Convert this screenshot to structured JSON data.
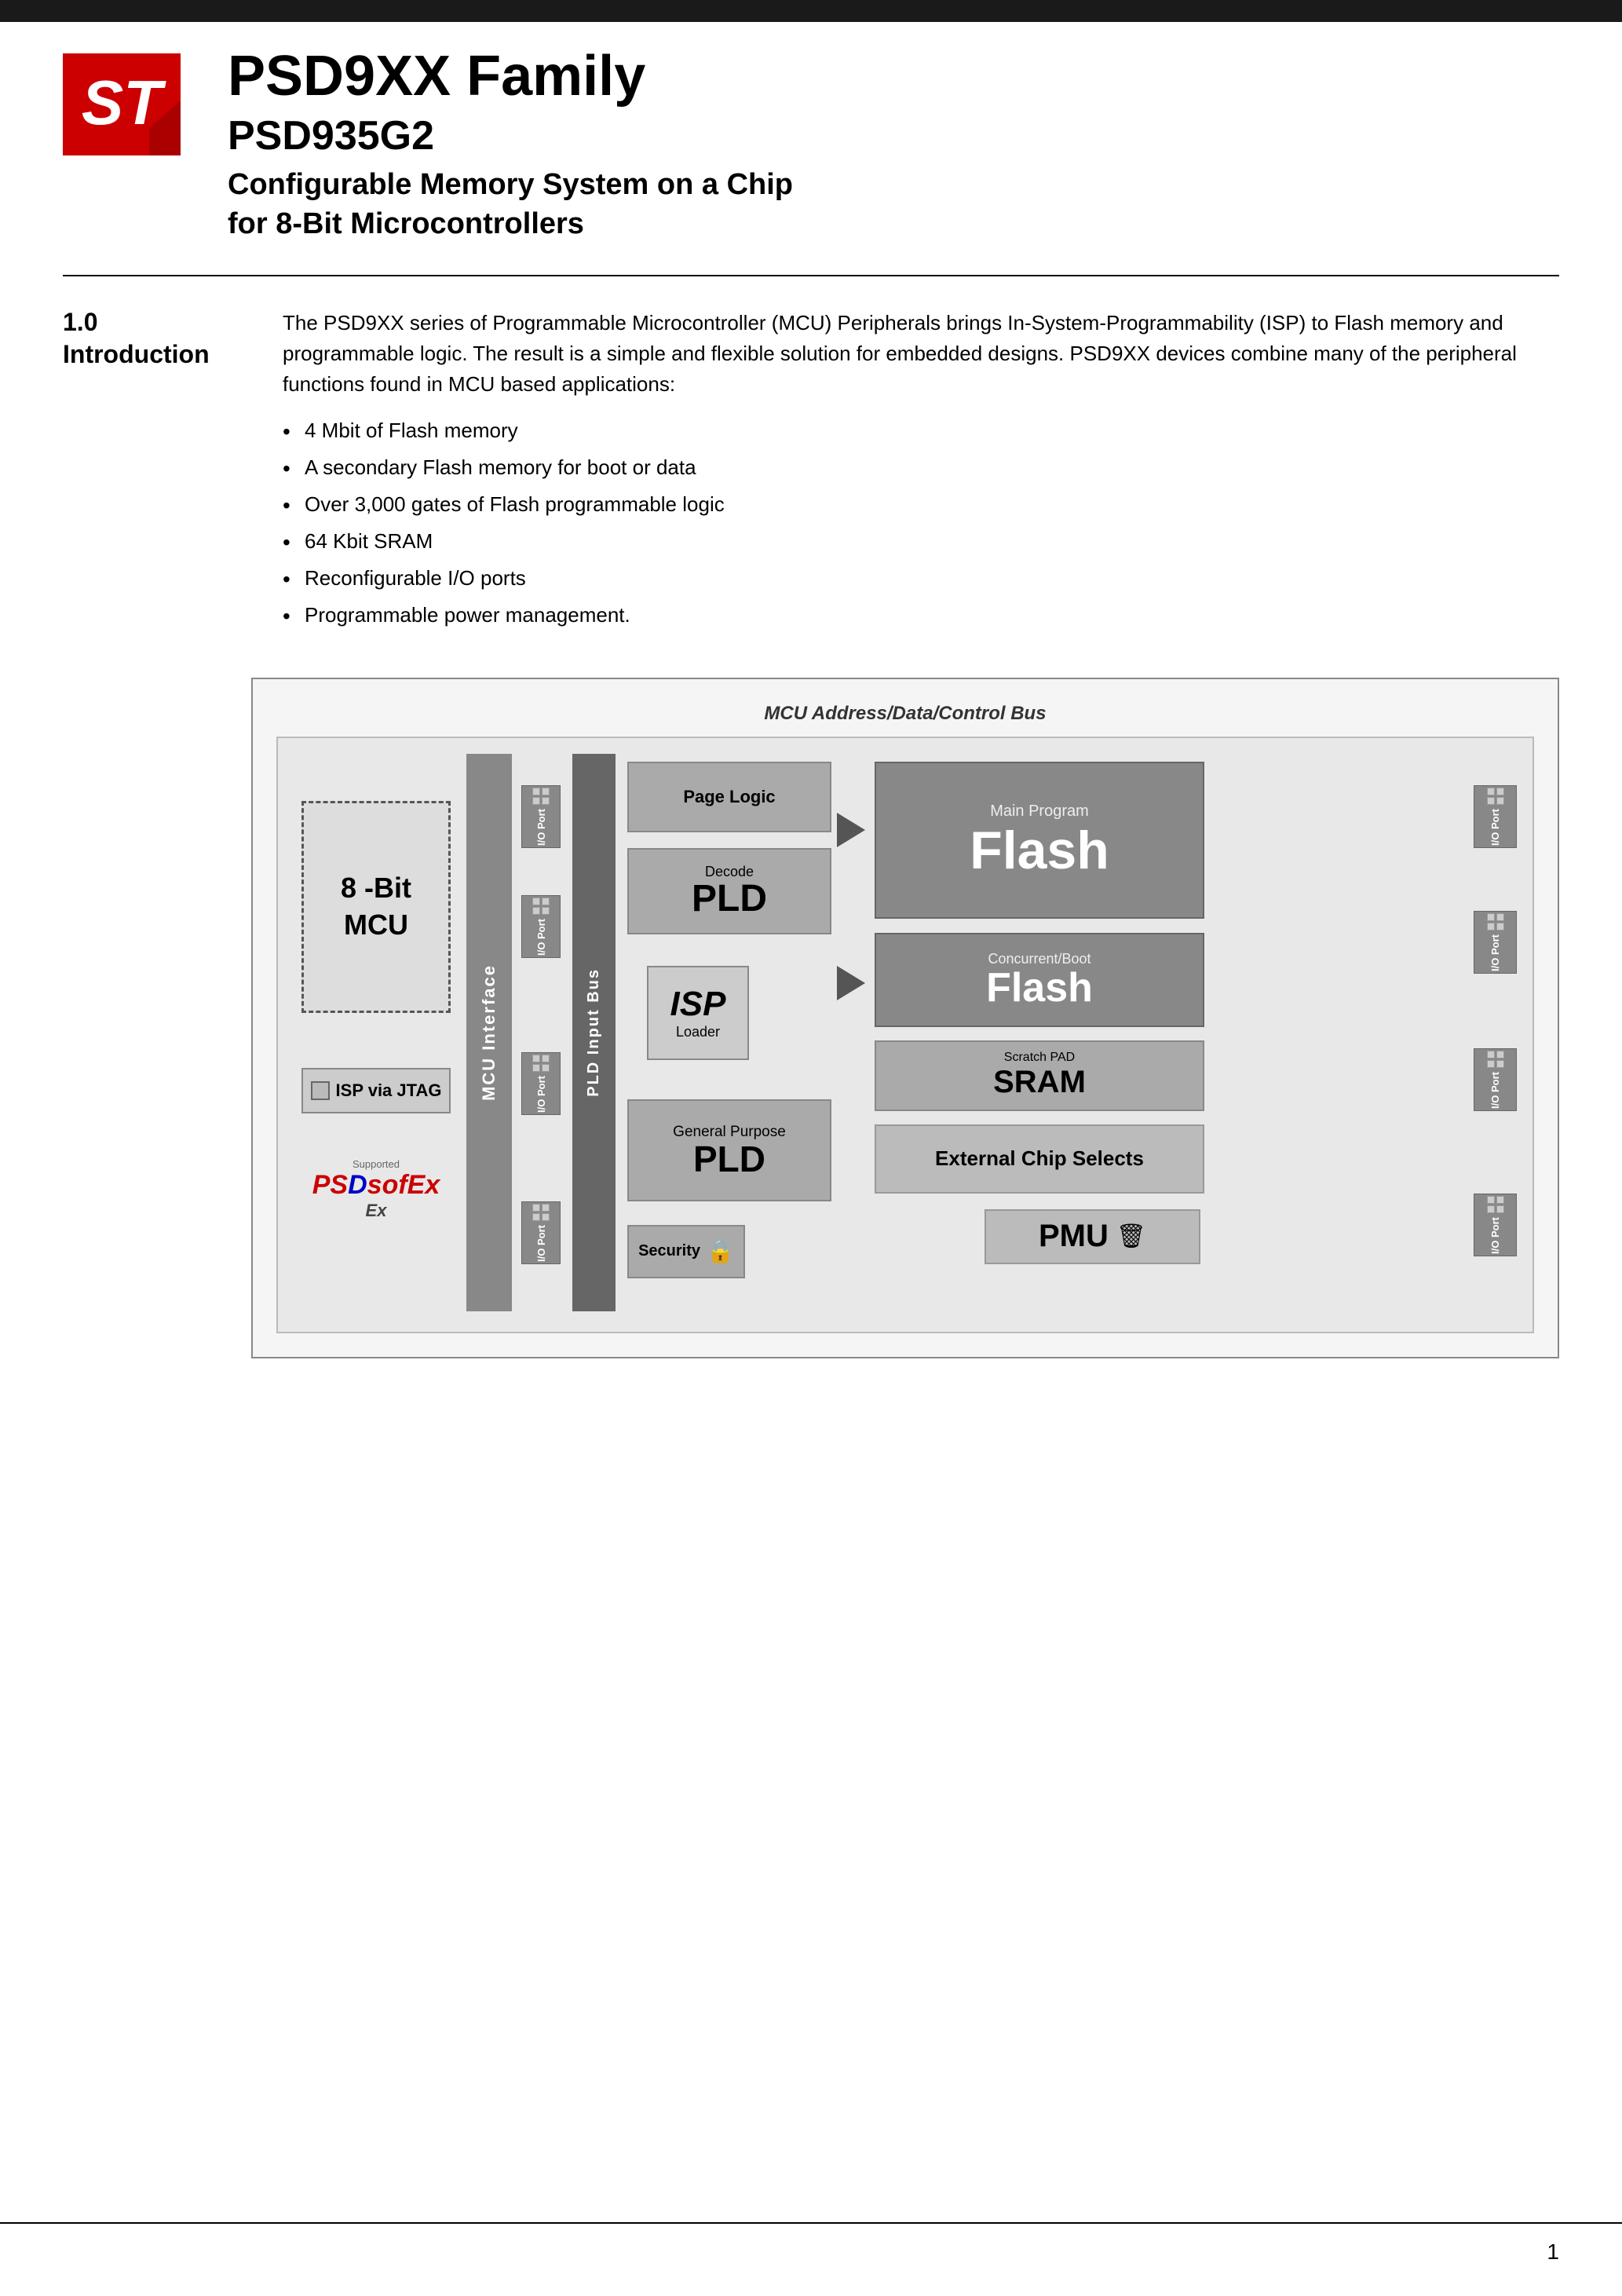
{
  "header": {
    "bar_color": "#1a1a1a",
    "product_family": "PSD9XX Family",
    "product_number": "PSD935G2",
    "product_description_line1": "Configurable Memory System on a Chip",
    "product_description_line2": "for 8-Bit Microcontrollers"
  },
  "section": {
    "number": "1.0",
    "title": "Introduction",
    "body_paragraph": "The PSD9XX series of Programmable Microcontroller (MCU) Peripherals brings In-System-Programmability (ISP) to Flash memory and programmable logic. The result is a simple and flexible solution for embedded designs. PSD9XX devices combine many of the peripheral functions found in MCU based applications:",
    "bullet_items": [
      "4 Mbit of Flash memory",
      "A secondary Flash memory for boot or data",
      "Over 3,000 gates of Flash programmable logic",
      "64 Kbit SRAM",
      "Reconfigurable I/O ports",
      "Programmable power management."
    ]
  },
  "diagram": {
    "bus_label": "MCU Address/Data/Control Bus",
    "mcu_label_line1": "8 -Bit",
    "mcu_label_line2": "MCU",
    "mcu_interface_label": "MCU Interface",
    "isp_jtag_label": "ISP via JTAG",
    "pld_input_bus_label": "PLD Input Bus",
    "page_logic_label": "Page Logic",
    "decode_label": "Decode",
    "pld_label": "PLD",
    "isp_label": "ISP",
    "loader_label": "Loader",
    "general_purpose_label": "General Purpose",
    "gp_pld_label": "PLD",
    "security_label": "Security",
    "pmu_label": "PMU",
    "main_program_label": "Main Program",
    "main_flash_label": "Flash",
    "concurrent_boot_label": "Concurrent/Boot",
    "concurrent_flash_label": "Flash",
    "scratch_pad_label": "Scratch PAD",
    "sram_label": "SRAM",
    "ext_chip_selects_label": "External Chip Selects",
    "io_port_label": "I/O Port",
    "supported_label": "Supported",
    "psd_logo": "PSDsoftEx"
  },
  "footer": {
    "page_number": "1"
  }
}
